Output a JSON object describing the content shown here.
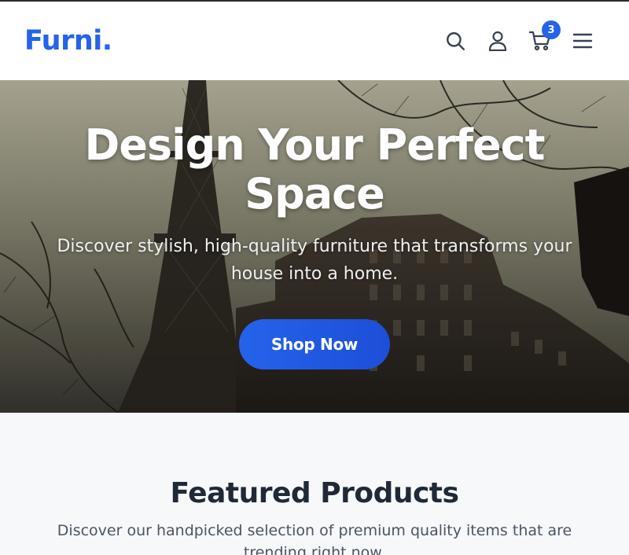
{
  "brand": {
    "name": "Furni",
    "dot": ".",
    "color": "#2563eb"
  },
  "header": {
    "icons": [
      "search-icon",
      "user-icon",
      "cart-icon",
      "menu-icon"
    ],
    "cart_count": "3"
  },
  "hero": {
    "title": "Design Your Perfect Space",
    "subtitle": "Discover stylish, high-quality furniture that transforms your house into a home.",
    "cta_label": "Shop Now"
  },
  "featured": {
    "title": "Featured Products",
    "subtitle": "Discover our handpicked selection of premium quality items that are trending right now."
  }
}
